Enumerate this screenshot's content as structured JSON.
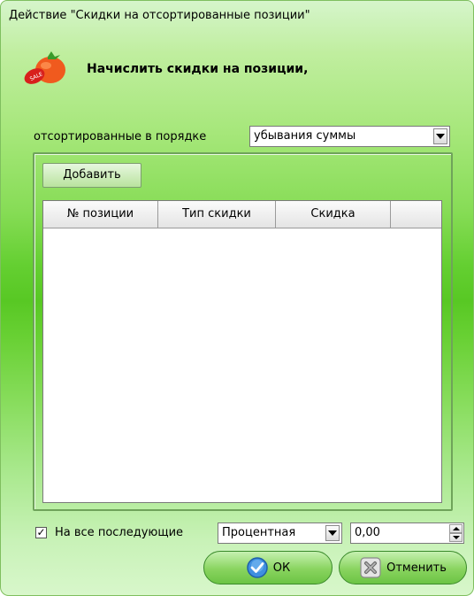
{
  "window": {
    "title": "Действие \"Скидки на отсортированные позиции\""
  },
  "header": {
    "text": "Начислить скидки на позиции,",
    "icon": "sale-tomato-icon"
  },
  "sort": {
    "label": "отсортированные в порядке",
    "value": "убывания суммы"
  },
  "toolbar": {
    "add_label": "Добавить"
  },
  "table": {
    "columns": [
      "№ позиции",
      "Тип скидки",
      "Скидка",
      ""
    ],
    "rows": []
  },
  "footer": {
    "apply_all_label": "На все последующие",
    "apply_all_checked": true,
    "discount_type": "Процентная",
    "discount_value": "0,00",
    "ok_label": "ОК",
    "cancel_label": "Отменить"
  },
  "colors": {
    "accent_green": "#64cf31",
    "button_border": "#3a8a2a"
  }
}
